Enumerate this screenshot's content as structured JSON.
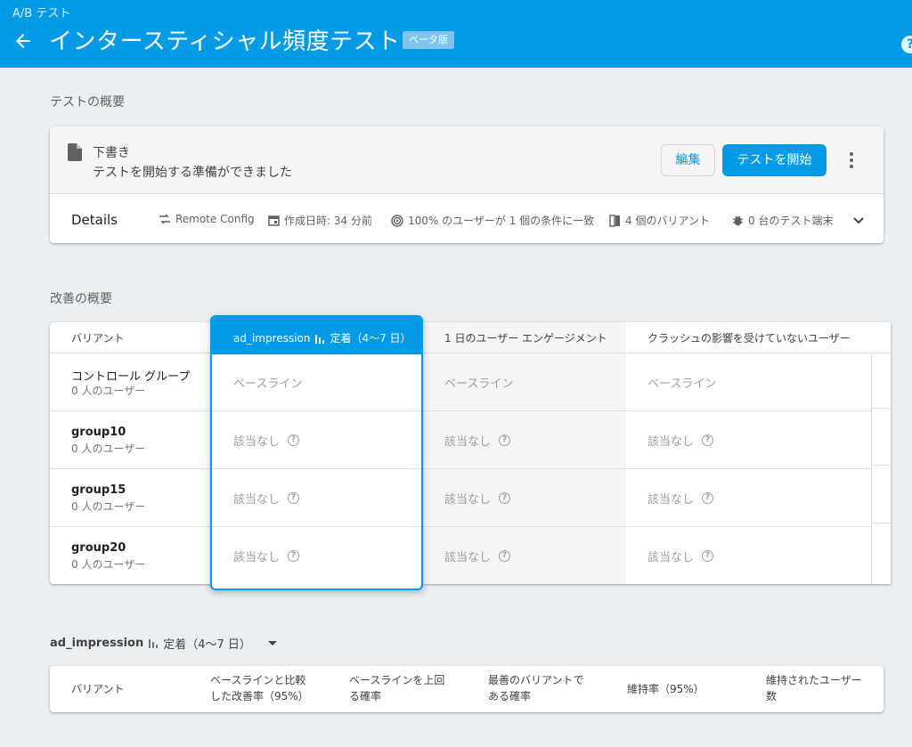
{
  "header": {
    "breadcrumb": "A/B テスト",
    "title": "インタースティシャル頻度テスト",
    "beta_badge": "ベータ版",
    "help_glyph": "?"
  },
  "overview": {
    "section_label": "テストの概要",
    "status_title": "下書き",
    "status_subtitle": "テストを開始する準備ができました",
    "edit_button": "編集",
    "start_button": "テストを開始",
    "details_label": "Details",
    "details": [
      {
        "icon": "remote-config-icon",
        "text": "Remote Config"
      },
      {
        "icon": "calendar-icon",
        "text": "作成日時: 34 分前"
      },
      {
        "icon": "target-icon",
        "text": "100% のユーザーが 1 個の条件に一致"
      },
      {
        "icon": "variants-icon",
        "text": "4 個のバリアント"
      },
      {
        "icon": "bug-icon",
        "text": "0 台のテスト端末"
      }
    ]
  },
  "improvement": {
    "section_label": "改善の概要",
    "columns": {
      "variant": "バリアント",
      "metric_name": "ad_impression",
      "metric_period": "定着（4〜7 日）",
      "engagement": "1 日のユーザー エンゲージメント",
      "crash_free": "クラッシュの影響を受けていないユーザー"
    },
    "rows": [
      {
        "name": "コントロール グループ",
        "users": "0 人のユーザー",
        "c1": "ベースライン",
        "c2": "ベースライン",
        "c3": "ベースライン"
      },
      {
        "name": "group10",
        "users": "0 人のユーザー",
        "c1": "該当なし",
        "c2": "該当なし",
        "c3": "該当なし"
      },
      {
        "name": "group15",
        "users": "0 人のユーザー",
        "c1": "該当なし",
        "c2": "該当なし",
        "c3": "該当なし"
      },
      {
        "name": "group20",
        "users": "0 人のユーザー",
        "c1": "該当なし",
        "c2": "該当なし",
        "c3": "該当なし"
      }
    ]
  },
  "detail_selector": {
    "metric_name": "ad_impression",
    "metric_period": "定着（4〜7 日）"
  },
  "detail_table": {
    "headers": {
      "variant": "バリアント",
      "improvement_1": "ベースラインと比較",
      "improvement_2": "した改善率（95%）",
      "prob_beat_1": "ベースラインを上回",
      "prob_beat_2": "る確率",
      "prob_best_1": "最善のバリアントで",
      "prob_best_2": "ある確率",
      "retention": "維持率（95%）",
      "retained_1": "維持されたユーザー",
      "retained_2": "数"
    }
  },
  "colors": {
    "accent": "#039be5",
    "background": "#eceff1"
  }
}
